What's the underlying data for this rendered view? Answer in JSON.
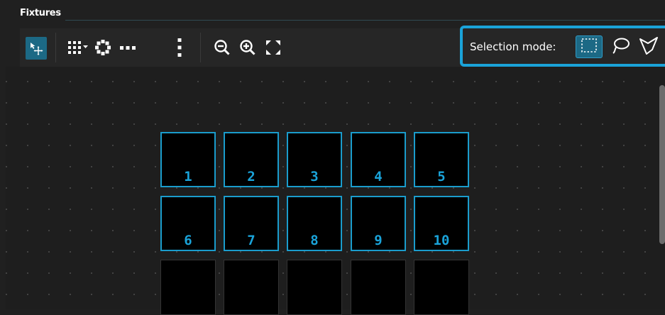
{
  "panel": {
    "title": "Fixtures"
  },
  "toolbar": {
    "tools": [
      {
        "name": "select-move",
        "icon": "cursor-move-icon",
        "active": true
      },
      {
        "name": "grid",
        "icon": "grid-dropdown-icon"
      },
      {
        "name": "circle",
        "icon": "circle-dots-icon"
      },
      {
        "name": "row",
        "icon": "horizontal-dots-icon"
      },
      {
        "name": "column",
        "icon": "vertical-dots-icon"
      },
      {
        "name": "zoom-out",
        "icon": "zoom-out-icon"
      },
      {
        "name": "zoom-in",
        "icon": "zoom-in-icon"
      },
      {
        "name": "fit",
        "icon": "fit-screen-icon"
      }
    ],
    "selection_mode": {
      "label": "Selection mode:",
      "modes": [
        {
          "name": "rectangle",
          "icon": "rectangle-select-icon",
          "active": true
        },
        {
          "name": "lasso",
          "icon": "lasso-icon"
        },
        {
          "name": "polygon",
          "icon": "polygon-select-icon"
        }
      ]
    }
  },
  "fixtures": [
    {
      "label": "1"
    },
    {
      "label": "2"
    },
    {
      "label": "3"
    },
    {
      "label": "4"
    },
    {
      "label": "5"
    },
    {
      "label": "6"
    },
    {
      "label": "7"
    },
    {
      "label": "8"
    },
    {
      "label": "9"
    },
    {
      "label": "10"
    },
    {
      "label": ""
    },
    {
      "label": ""
    },
    {
      "label": ""
    },
    {
      "label": ""
    },
    {
      "label": ""
    }
  ],
  "colors": {
    "accent": "#1aa3d9",
    "background": "#202020",
    "active_button": "#1c6985"
  }
}
